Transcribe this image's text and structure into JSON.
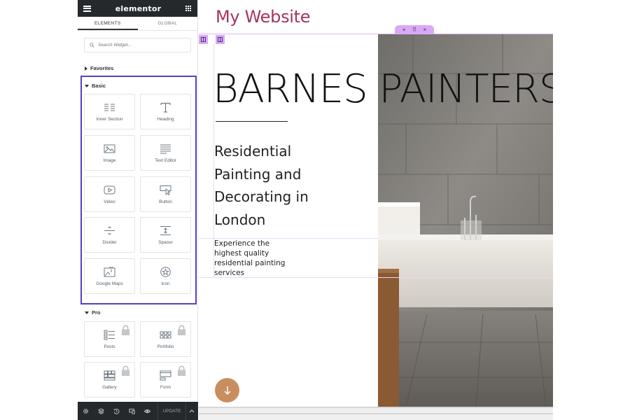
{
  "app": {
    "brand": "elementor",
    "tabs": [
      "ELEMENTS",
      "GLOBAL"
    ],
    "search_placeholder": "Search Widget..."
  },
  "categories": {
    "favorites": "Favorites",
    "basic": "Basic",
    "pro": "Pro"
  },
  "basic_widgets": [
    {
      "label": "Inner Section",
      "icon": "inner-section-icon"
    },
    {
      "label": "Heading",
      "icon": "heading-icon"
    },
    {
      "label": "Image",
      "icon": "image-icon"
    },
    {
      "label": "Text Editor",
      "icon": "text-editor-icon"
    },
    {
      "label": "Video",
      "icon": "video-icon"
    },
    {
      "label": "Button",
      "icon": "button-icon"
    },
    {
      "label": "Divider",
      "icon": "divider-icon"
    },
    {
      "label": "Spacer",
      "icon": "spacer-icon"
    },
    {
      "label": "Google Maps",
      "icon": "google-maps-icon"
    },
    {
      "label": "Icon",
      "icon": "star-icon"
    }
  ],
  "pro_widgets": [
    {
      "label": "Posts",
      "icon": "posts-icon",
      "locked": true
    },
    {
      "label": "Portfolio",
      "icon": "portfolio-icon",
      "locked": true
    },
    {
      "label": "Gallery",
      "icon": "gallery-icon",
      "locked": true
    },
    {
      "label": "Form",
      "icon": "form-icon",
      "locked": true
    }
  ],
  "footer": {
    "update_label": "UPDATE",
    "icons": [
      "settings-icon",
      "layers-icon",
      "history-icon",
      "responsive-icon",
      "preview-icon"
    ]
  },
  "canvas": {
    "site_title": "My Website",
    "heading": "BARNES PAINTERS",
    "subheading_lines": [
      "Residential",
      "Painting and",
      "Decorating in",
      "London"
    ],
    "paragraph_lines": [
      "Experience the",
      "highest quality",
      "residential painting",
      "services"
    ],
    "section_controls": [
      "+",
      "⠿",
      "×"
    ]
  },
  "colors": {
    "accent_title": "#a8345e",
    "selection": "#5b3fc4",
    "editor_handle": "#d9a9f5",
    "fab": "#c98e5e",
    "panel_dark": "#26292c"
  }
}
